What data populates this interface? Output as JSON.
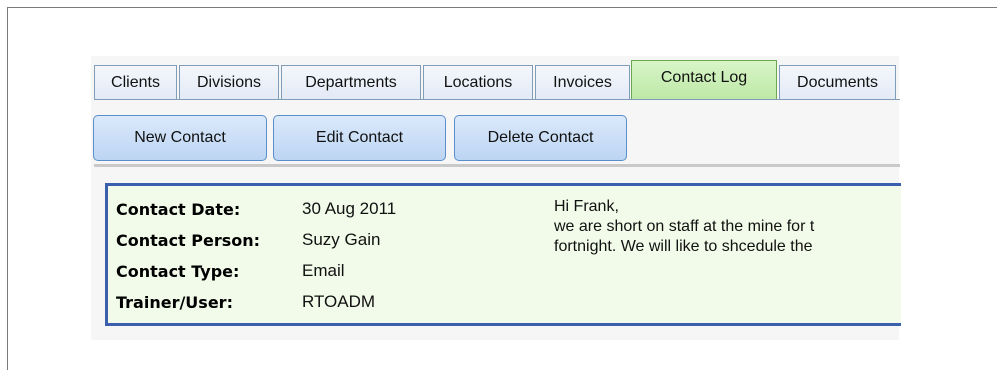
{
  "tabs": [
    {
      "label": "Clients",
      "active": false
    },
    {
      "label": "Divisions",
      "active": false
    },
    {
      "label": "Departments",
      "active": false
    },
    {
      "label": "Locations",
      "active": false
    },
    {
      "label": "Invoices",
      "active": false
    },
    {
      "label": "Contact Log",
      "active": true
    },
    {
      "label": "Documents",
      "active": false
    }
  ],
  "toolbar": {
    "new_label": "New Contact",
    "edit_label": "Edit Contact",
    "delete_label": "Delete Contact"
  },
  "contact": {
    "date_label": "Contact Date:",
    "date_value": "30 Aug 2011",
    "person_label": "Contact Person:",
    "person_value": "Suzy Gain",
    "type_label": "Contact Type:",
    "type_value": "Email",
    "trainer_label": "Trainer/User:",
    "trainer_value": "RTOADM",
    "note_lines": [
      "Hi Frank,",
      "we are short on staff at the mine for t",
      "fortnight. We will like to shcedule the"
    ]
  },
  "colors": {
    "active_tab": "#bde8a6",
    "button": "#bcd5f3",
    "detail_border": "#3a5fad",
    "detail_bg": "#f2fbe9"
  }
}
